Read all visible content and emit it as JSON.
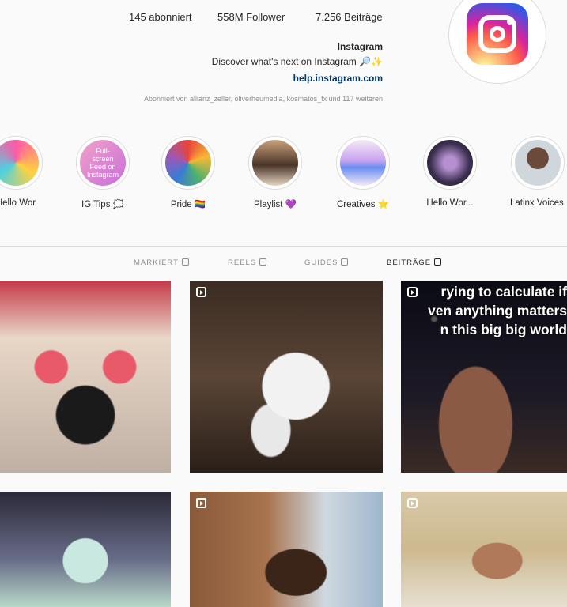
{
  "stats": {
    "posts": "7.256 Beiträge",
    "followers": "558M Follower",
    "following": "145 abonniert"
  },
  "bio": {
    "name": "Instagram",
    "line": "Discover what's next on Instagram 🔎✨",
    "link": "help.instagram.com"
  },
  "followed_by": "Abonniert von allianz_zeller, oliverheumedia, kosmatos_fx und 117 weiteren",
  "highlights": [
    {
      "label": "Latinx Voices"
    },
    {
      "label": "Hello Wor..."
    },
    {
      "label": "Creatives ⭐"
    },
    {
      "label": "Playlist 💜"
    },
    {
      "label": "Pride 🏳️‍🌈"
    },
    {
      "label": "IG Tips 🗯️"
    },
    {
      "label": "Hello Wor"
    }
  ],
  "ig_tips_circle_text": "Full-screen Feed on Instagram",
  "tabs": {
    "posts": "BEITRÄGE",
    "guides": "GUIDES",
    "reels": "REELS",
    "tagged": "MARKIERT"
  },
  "tile_text": {
    "lines": [
      "rying to calculate if",
      "ven anything matters",
      "n this big big world"
    ]
  },
  "colors": {
    "link": "#00376b",
    "muted": "#8e8e8e",
    "border": "#dbdbdb"
  }
}
